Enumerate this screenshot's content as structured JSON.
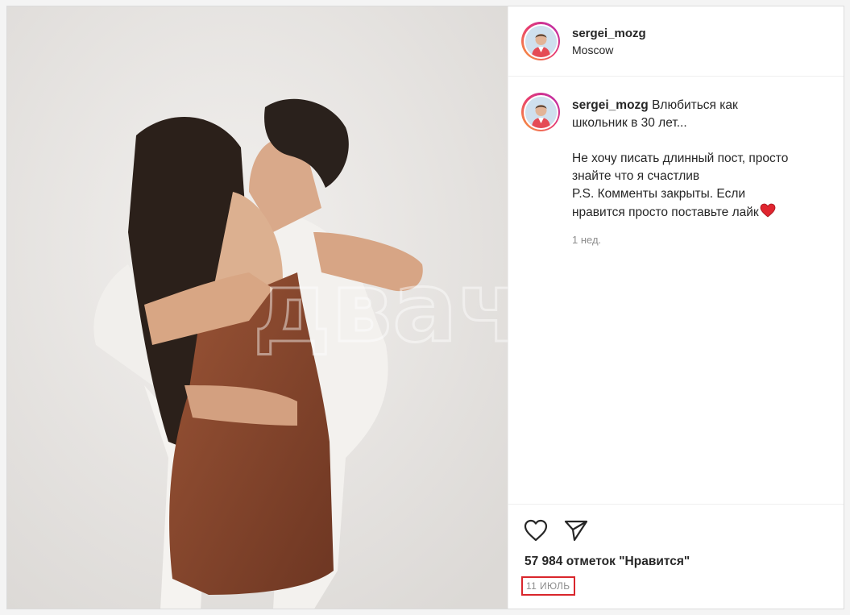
{
  "post": {
    "username": "sergei_mozg",
    "location": "Moscow",
    "caption_lines": [
      "Влюбиться как",
      "школьник в 30 лет..."
    ],
    "body_lines": [
      "Не хочу писать длинный пост, просто",
      "знайте что я счастлив",
      "P.S. Комменты закрыты. Если",
      "нравится просто поставьте лайк"
    ],
    "caption_time": "1 нед.",
    "likes": "57 984 отметок \"Нравится\"",
    "date": "11 ИЮЛЬ",
    "watermark": "двач"
  },
  "icons": {
    "like": "heart-outline-icon",
    "share": "paper-plane-icon",
    "emoji": "red-heart-emoji"
  },
  "colors": {
    "date_highlight": "#d9262c",
    "dress": "#8a4a30",
    "heart_emoji": "#e0252f"
  }
}
